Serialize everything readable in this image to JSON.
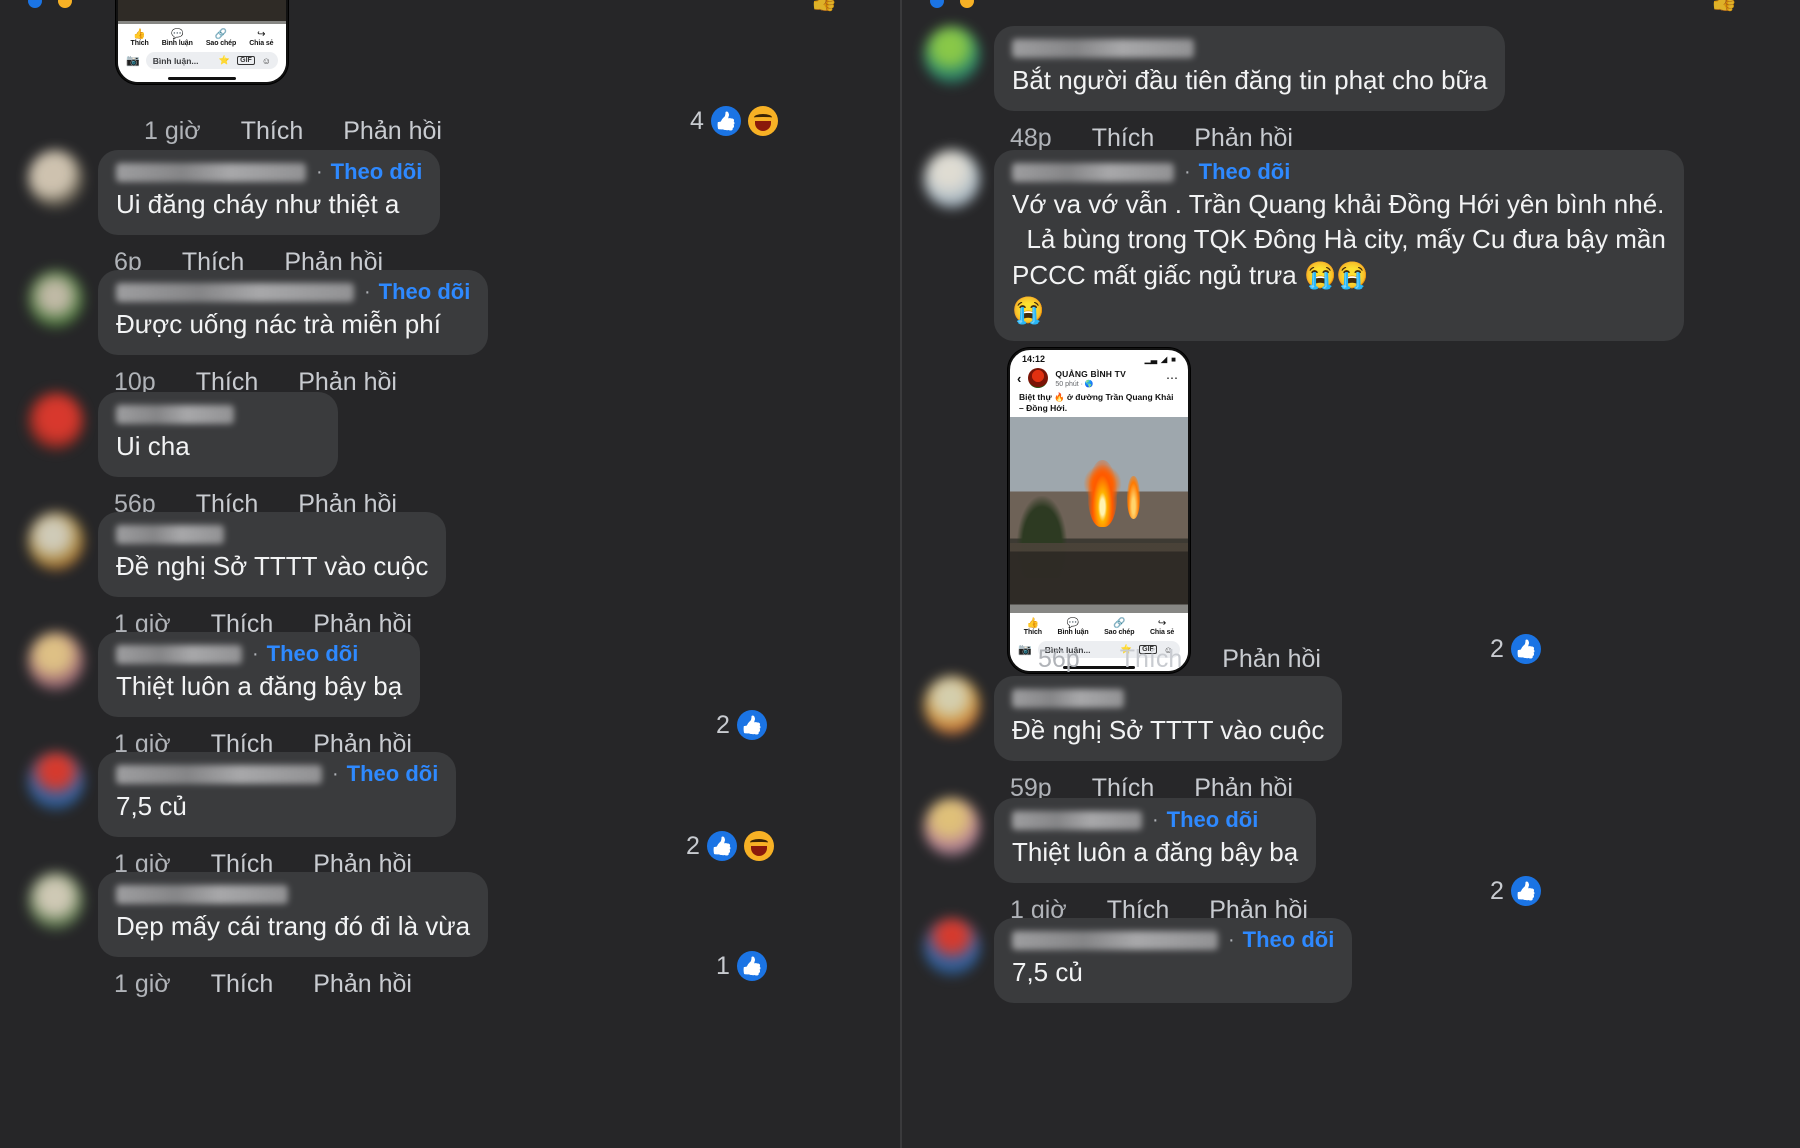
{
  "meta": {
    "app": "Facebook comments",
    "theme": "dark",
    "bg_color": "#262628",
    "bubble_color": "#3a3b3d",
    "link_color": "#2e89ff",
    "like_color": "#1b74e4",
    "haha_color": "#f7b125",
    "text_color": "#f2f3f4",
    "muted_color": "#b0b3b8"
  },
  "labels": {
    "like": "Thích",
    "reply": "Phản hồi",
    "follow": "Theo dõi",
    "separator": "·"
  },
  "left_panel": {
    "phone_card": {
      "actions": [
        "Thích",
        "Bình luận",
        "Sao chép",
        "Chia sẻ"
      ],
      "composer_placeholder": "Bình luận..."
    },
    "comments": [
      {
        "name_blurred": true,
        "text": "",
        "time": "1 giờ",
        "like": "Thích",
        "reply": "Phản hồi",
        "reaction_count": "4",
        "reactions": [
          "like",
          "haha"
        ],
        "has_attachment": true
      },
      {
        "name_blurred": true,
        "follow": "Theo dõi",
        "text": "Ui đăng cháy như thiệt a",
        "time": "6p",
        "like": "Thích",
        "reply": "Phản hồi",
        "reaction_count": "",
        "reactions": []
      },
      {
        "name_blurred": true,
        "follow": "Theo dõi",
        "text": "Được uống nác trà miễn phí",
        "time": "10p",
        "like": "Thích",
        "reply": "Phản hồi",
        "reaction_count": "",
        "reactions": []
      },
      {
        "name_blurred": true,
        "text": "Ui cha",
        "time": "56p",
        "like": "Thích",
        "reply": "Phản hồi",
        "reaction_count": "",
        "reactions": []
      },
      {
        "name_blurred": true,
        "text": "Đề nghị Sở TTTT vào cuộc",
        "time": "1 giờ",
        "like": "Thích",
        "reply": "Phản hồi",
        "reaction_count": "",
        "reactions": []
      },
      {
        "name_blurred": true,
        "follow": "Theo dõi",
        "text": "Thiệt luôn a đăng bậy bạ",
        "time": "1 giờ",
        "like": "Thích",
        "reply": "Phản hồi",
        "reaction_count": "2",
        "reactions": [
          "like"
        ]
      },
      {
        "name_blurred": true,
        "follow": "Theo dõi",
        "text": "7,5 củ",
        "time": "1 giờ",
        "like": "Thích",
        "reply": "Phản hồi",
        "reaction_count": "2",
        "reactions": [
          "like",
          "haha"
        ]
      },
      {
        "name_blurred": true,
        "text": "Dẹp mấy cái trang đó đi là vừa",
        "time": "1 giờ",
        "like": "Thích",
        "reply": "Phản hồi",
        "reaction_count": "1",
        "reactions": [
          "like"
        ]
      }
    ]
  },
  "right_panel": {
    "phone_card": {
      "status_time": "14:12",
      "page_name": "QUẢNG BÌNH TV",
      "post_time": "50 phút",
      "caption": "Biệt thự 🔥 ở đường Trần Quang Khải – Đồng Hới.",
      "actions": [
        "Thích",
        "Bình luận",
        "Sao chép",
        "Chia sẻ"
      ],
      "composer_placeholder": "Bình luận...",
      "more_icon": "ellipsis-icon",
      "back_icon": "back-chevron-icon"
    },
    "comments": [
      {
        "name_blurred": true,
        "text": "Bắt người đầu tiên đăng tin phạt cho bữa",
        "time": "48p",
        "like": "Thích",
        "reply": "Phản hồi",
        "reaction_count": "",
        "reactions": []
      },
      {
        "name_blurred": true,
        "follow": "Theo dõi",
        "text": "Vớ va vớ vẫn . Trần Quang khải Đồng Hới yên bình nhé.\n  Lả bùng trong TQK Đông Hà city, mấy Cu đưa bậy mần PCCC mất giấc ngủ trưa 😭😭\n😭",
        "time": "56p",
        "like": "Thích",
        "reply": "Phản hồi",
        "reaction_count": "2",
        "reactions": [
          "like"
        ],
        "has_attachment": true
      },
      {
        "name_blurred": true,
        "text": "Đề nghị Sở TTTT vào cuộc",
        "time": "59p",
        "like": "Thích",
        "reply": "Phản hồi",
        "reaction_count": "",
        "reactions": []
      },
      {
        "name_blurred": true,
        "follow": "Theo dõi",
        "text": "Thiệt luôn a đăng bậy bạ",
        "time": "1 giờ",
        "like": "Thích",
        "reply": "Phản hồi",
        "reaction_count": "2",
        "reactions": [
          "like"
        ]
      },
      {
        "name_blurred": true,
        "follow": "Theo dõi",
        "text": "7,5 củ",
        "time": "",
        "like": "",
        "reply": "",
        "reaction_count": "",
        "reactions": []
      }
    ]
  }
}
